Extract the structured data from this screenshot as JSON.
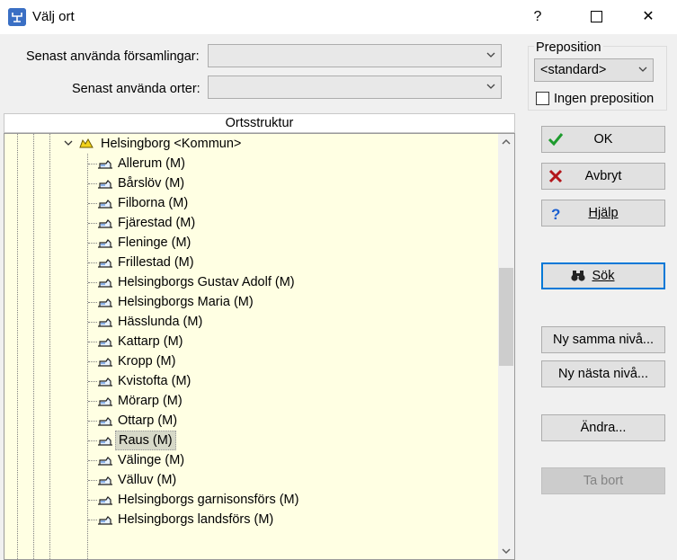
{
  "window": {
    "title": "Välj ort",
    "help_glyph": "?",
    "close_glyph": "✕"
  },
  "recent": {
    "parishes_label": "Senast använda församlingar:",
    "places_label": "Senast använda orter:",
    "parishes_value": "",
    "places_value": ""
  },
  "preposition": {
    "group_label": "Preposition",
    "value": "<standard>",
    "no_preposition_label": "Ingen preposition",
    "no_preposition_checked": false
  },
  "tree": {
    "header": "Ortsstruktur",
    "root_label": "Helsingborg <Kommun>",
    "items": [
      "Allerum (M)",
      "Bårslöv (M)",
      "Filborna (M)",
      "Fjärestad (M)",
      "Fleninge (M)",
      "Frillestad (M)",
      "Helsingborgs Gustav Adolf (M)",
      "Helsingborgs Maria (M)",
      "Hässlunda (M)",
      "Kattarp (M)",
      "Kropp (M)",
      "Kvistofta (M)",
      "Mörarp (M)",
      "Ottarp (M)",
      "Raus (M)",
      "Välinge (M)",
      "Välluv (M)",
      "Helsingborgs garnisonsförs (M)",
      "Helsingborgs landsförs (M)"
    ],
    "selected_index": 14,
    "scroll": {
      "thumb_fraction_start": 0.3,
      "thumb_fraction_size": 0.25
    }
  },
  "buttons": {
    "ok": "OK",
    "cancel": "Avbryt",
    "help": "Hjälp",
    "search": "Sök",
    "new_same_level": "Ny samma nivå...",
    "new_next_level": "Ny nästa nivå...",
    "edit": "Ändra...",
    "delete": "Ta bort"
  },
  "icons": {
    "app": "family-tree-app-icon",
    "ok": "green-check-icon",
    "cancel": "red-x-icon",
    "help": "blue-question-icon",
    "search": "binoculars-icon",
    "tree_item": "parish-church-icon",
    "tree_root": "municipality-icon"
  },
  "colors": {
    "tree_background": "#ffffe3",
    "selection": "#d7d9c8",
    "default_button_border": "#0078d7",
    "ok_green": "#1e9b2e",
    "cancel_red": "#b3151a",
    "help_blue": "#1a5fd0"
  }
}
